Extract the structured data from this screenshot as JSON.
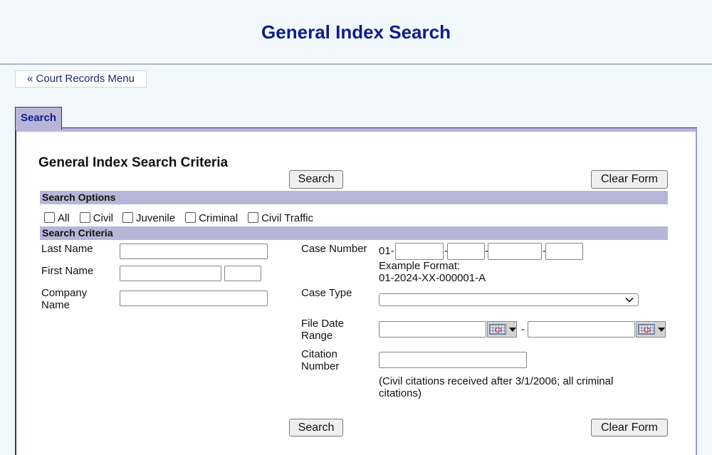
{
  "header": {
    "title": "General Index Search"
  },
  "nav": {
    "back_link": "« Court Records Menu"
  },
  "tabs": [
    {
      "label": "Search",
      "active": true
    }
  ],
  "form": {
    "title": "General Index Search Criteria",
    "search_button": "Search",
    "clear_button": "Clear Form",
    "search_options": {
      "heading": "Search Options",
      "checkboxes": [
        {
          "label": "All",
          "checked": false
        },
        {
          "label": "Civil",
          "checked": false
        },
        {
          "label": "Juvenile",
          "checked": false
        },
        {
          "label": "Criminal",
          "checked": false
        },
        {
          "label": "Civil Traffic",
          "checked": false
        }
      ]
    },
    "search_criteria": {
      "heading": "Search Criteria",
      "last_name": {
        "label": "Last Name",
        "value": ""
      },
      "first_name": {
        "label": "First Name",
        "value": "",
        "middle_value": ""
      },
      "company_name": {
        "label": "Company Name",
        "value": ""
      },
      "case_number": {
        "label": "Case Number",
        "prefix": "01-",
        "separator": "-",
        "parts": [
          "",
          "",
          "",
          ""
        ],
        "example_label": "Example Format:",
        "example_value": "01-2024-XX-000001-A"
      },
      "case_type": {
        "label": "Case Type",
        "selected": ""
      },
      "file_date_range": {
        "label": "File Date Range",
        "from": "",
        "to": "",
        "separator": "-"
      },
      "citation_number": {
        "label": "Citation Number",
        "value": "",
        "note": "(Civil citations received after 3/1/2006; all criminal citations)"
      }
    }
  },
  "colors": {
    "page_bg": "#f1f9fd",
    "title_blue": "#0f1b8c",
    "section_bar": "#b8b6d8",
    "panel_border": "#2e3275"
  }
}
